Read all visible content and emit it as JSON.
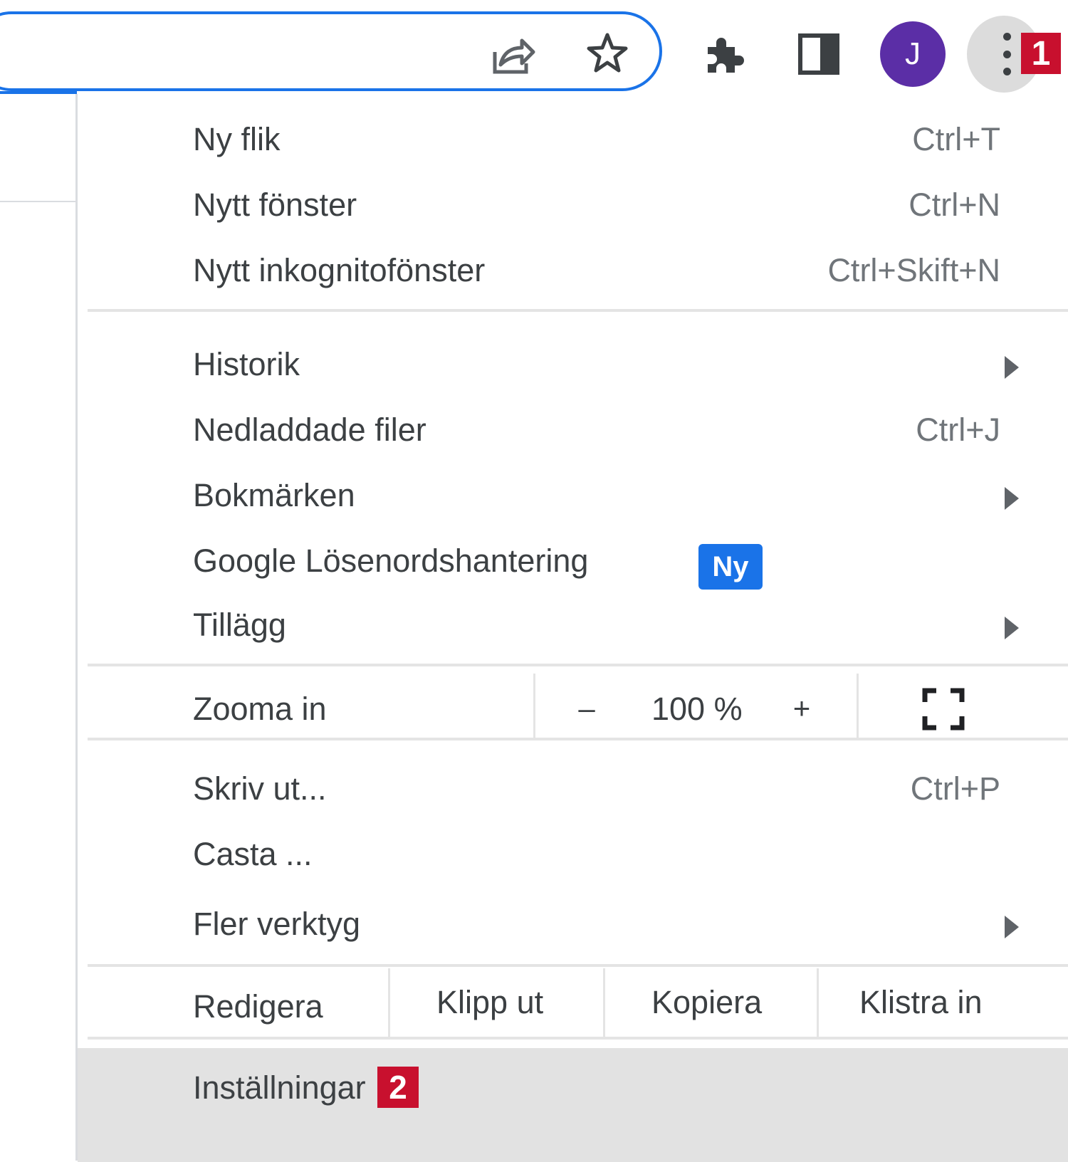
{
  "toolbar": {
    "avatar_initial": "J",
    "icons": [
      "share-icon",
      "star-icon",
      "extensions-puzzle-icon",
      "side-panel-icon",
      "more-vert-icon"
    ]
  },
  "annotations": {
    "step1": "1",
    "step2": "2"
  },
  "menu": {
    "group1": [
      {
        "label": "Ny flik",
        "shortcut": "Ctrl+T"
      },
      {
        "label": "Nytt fönster",
        "shortcut": "Ctrl+N"
      },
      {
        "label": "Nytt inkognitofönster",
        "shortcut": "Ctrl+Skift+N"
      }
    ],
    "group2": [
      {
        "label": "Historik"
      },
      {
        "label": "Nedladdade filer",
        "shortcut": "Ctrl+J"
      },
      {
        "label": "Bokmärken"
      },
      {
        "label": "Google Lösenordshantering",
        "badge": "Ny"
      },
      {
        "label": "Tillägg"
      }
    ],
    "zoom": {
      "label": "Zooma in",
      "minus": "–",
      "value": "100 %",
      "plus": "+"
    },
    "group3": [
      {
        "label": "Skriv ut...",
        "shortcut": "Ctrl+P"
      },
      {
        "label": "Casta ..."
      },
      {
        "label": "Fler verktyg"
      }
    ],
    "edit": {
      "label": "Redigera",
      "cut": "Klipp ut",
      "copy": "Kopiera",
      "paste": "Klistra in"
    },
    "settings": {
      "label": "Inställningar"
    }
  },
  "colors": {
    "accent": "#1a73e8",
    "annotation": "#c8102e",
    "avatar": "#5b2ea6",
    "highlight": "#e2e2e2"
  }
}
